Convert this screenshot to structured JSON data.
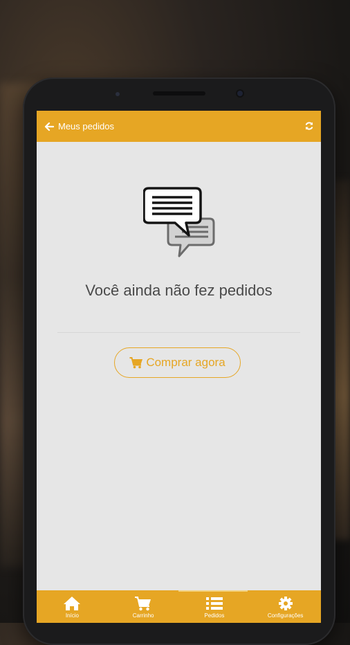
{
  "app": {
    "header": {
      "title": "Meus pedidos",
      "back_icon": "arrow-left-icon",
      "refresh_icon": "refresh-icon"
    },
    "empty_state": {
      "icon": "chat-bubbles-icon",
      "message": "Você ainda não fez pedidos",
      "button_label": "Comprar agora",
      "button_icon": "cart-icon"
    },
    "bottom_nav": [
      {
        "label": "Início",
        "icon": "home-icon"
      },
      {
        "label": "Carrinho",
        "icon": "cart-icon"
      },
      {
        "label": "Pedidos",
        "icon": "list-icon"
      },
      {
        "label": "Configurações",
        "icon": "gear-icon"
      }
    ]
  },
  "colors": {
    "accent": "#e6a624",
    "background": "#e6e6e6",
    "text": "#4a4a4a"
  }
}
